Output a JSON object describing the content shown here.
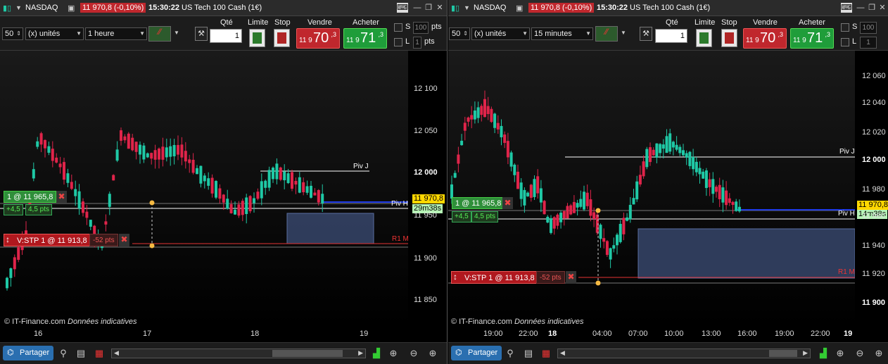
{
  "colors": {
    "up": "#1fc9a6",
    "down": "#e0244a",
    "sell": "#c0272d",
    "buy": "#1f9d3a",
    "pivot": "#ffffff",
    "r1": "#e33333",
    "zone": "#3a4a70",
    "bluelevel": "#1f3be8"
  },
  "icons": [
    "candles-icon",
    "chevron-down-icon",
    "maximize-icon",
    "keyboard-icon",
    "minimize-icon",
    "restore-icon",
    "close-icon",
    "wrench-icon",
    "indicator-icon",
    "share-icon",
    "zoom-in-icon",
    "zoom-out-icon",
    "zoom-fit-icon"
  ],
  "left": {
    "title": {
      "symbol": "NASDAQ",
      "change": "11 970,8 (-0,10%)",
      "time": "15:30:22",
      "name": "US Tech 100 Cash (1€)"
    },
    "toolbar": {
      "count": "50",
      "units": "(x) unités",
      "timeframe": "1 heure",
      "qty_label": "Qté",
      "qty_value": "1",
      "limit_label": "Limite",
      "stop_label": "Stop",
      "sell_label": "Vendre",
      "buy_label": "Acheter",
      "sell_prefix": "11 9",
      "sell_big": "70",
      "sell_sup": ",3",
      "buy_prefix": "11 9",
      "buy_big": "71",
      "buy_sup": ",3",
      "s_label": "S",
      "s_value": "100",
      "l_label": "L",
      "l_value": "1",
      "pts": "pts"
    },
    "yaxis": [
      "12 100",
      "12 050",
      "12 000",
      "11 950",
      "11 900",
      "11 850"
    ],
    "xaxis": [
      "16",
      "17",
      "18",
      "19"
    ],
    "pivot": "Piv J",
    "pivot2": "Piv H",
    "r1": "R1 M",
    "price_tag": "11 970,8",
    "time_tag": "29m38s",
    "position": {
      "label": "1 @ 11 965,8",
      "pnl_pts": "+4,5",
      "pnl_eur": "4,5 pts"
    },
    "stop": {
      "label": "V:STP  1 @ 11 913,8",
      "dist": "-52 pts"
    },
    "credit": "© IT-Finance.com",
    "credit_note": "Données indicatives",
    "share": "Partager"
  },
  "right": {
    "title": {
      "symbol": "NASDAQ",
      "change": "11 970,8 (-0,10%)",
      "time": "15:30:22",
      "name": "US Tech 100 Cash (1€)"
    },
    "toolbar": {
      "count": "50",
      "units": "(x) unités",
      "timeframe": "15 minutes",
      "qty_label": "Qté",
      "qty_value": "1",
      "limit_label": "Limite",
      "stop_label": "Stop",
      "sell_label": "Vendre",
      "buy_label": "Acheter",
      "sell_prefix": "11 9",
      "sell_big": "70",
      "sell_sup": ",3",
      "buy_prefix": "11 9",
      "buy_big": "71",
      "buy_sup": ",3",
      "s_label": "S",
      "s_value": "100",
      "l_label": "L",
      "l_value": "1",
      "pts": "pts"
    },
    "yaxis": [
      "12 060",
      "12 040",
      "12 020",
      "12 000",
      "11 980",
      "11 960",
      "11 940",
      "11 920",
      "11 900"
    ],
    "xaxis": [
      "19:00",
      "22:00",
      "18",
      "04:00",
      "07:00",
      "10:00",
      "13:00",
      "16:00",
      "19:00",
      "22:00",
      "19"
    ],
    "pivot": "Piv J",
    "pivot2": "Piv H",
    "r1": "R1 M",
    "price_tag": "11 970,8",
    "time_tag": "14m38s",
    "position": {
      "label": "1 @ 11 965,8",
      "pnl_pts": "+4,5",
      "pnl_eur": "4,5 pts"
    },
    "stop": {
      "label": "V:STP  1 @ 11 913,8",
      "dist": "-52 pts"
    },
    "credit": "© IT-Finance.com",
    "credit_note": "Données indicatives",
    "share": "Partager"
  }
}
